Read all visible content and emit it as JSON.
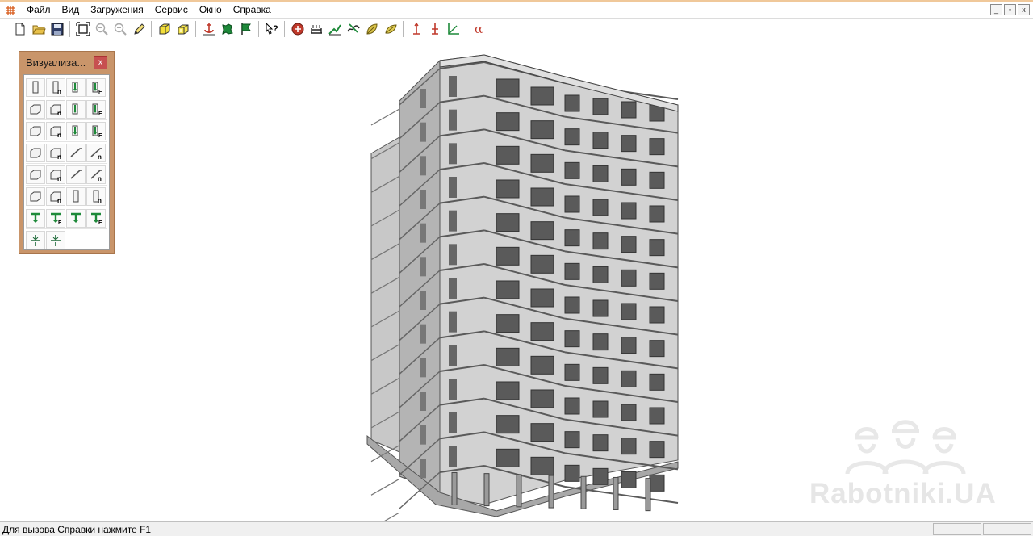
{
  "menu": {
    "items": [
      "Файл",
      "Вид",
      "Загружения",
      "Сервис",
      "Окно",
      "Справка"
    ]
  },
  "window_controls": {
    "minimize": "_",
    "restore": "▫",
    "close": "x"
  },
  "toolbar": {
    "groups": [
      [
        "new-file-icon",
        "open-folder-icon",
        "save-icon"
      ],
      [
        "fit-view-icon",
        "zoom-out-icon",
        "zoom-in-icon",
        "pencil-icon"
      ],
      [
        "cube-yellow-icon",
        "cube-yellow-open-icon"
      ],
      [
        "anchor-icon",
        "deform-icon",
        "flag-icon"
      ],
      [
        "help-cursor-icon"
      ],
      [
        "load-red-icon",
        "load-bed-icon",
        "load-stack-icon",
        "load-wave-icon",
        "load-leaf-icon",
        "load-leaf-alt-icon"
      ],
      [
        "axis-red-icon",
        "axis-red-alt-icon",
        "axis-green-icon"
      ],
      [
        "alpha-icon"
      ]
    ]
  },
  "viz_panel": {
    "title": "Визуализа...",
    "close_label": "x"
  },
  "watermark": {
    "text": "Rabotniki.UA"
  },
  "status": {
    "help_text": "Для вызова Справки нажмите F1"
  },
  "colors": {
    "panel_frame": "#c9956a",
    "close_button": "#c75050",
    "building_light": "#d2d2d2",
    "building_mid": "#b4b4b4",
    "building_dark": "#5a5a5a",
    "watermark": "#e6e6e6"
  }
}
